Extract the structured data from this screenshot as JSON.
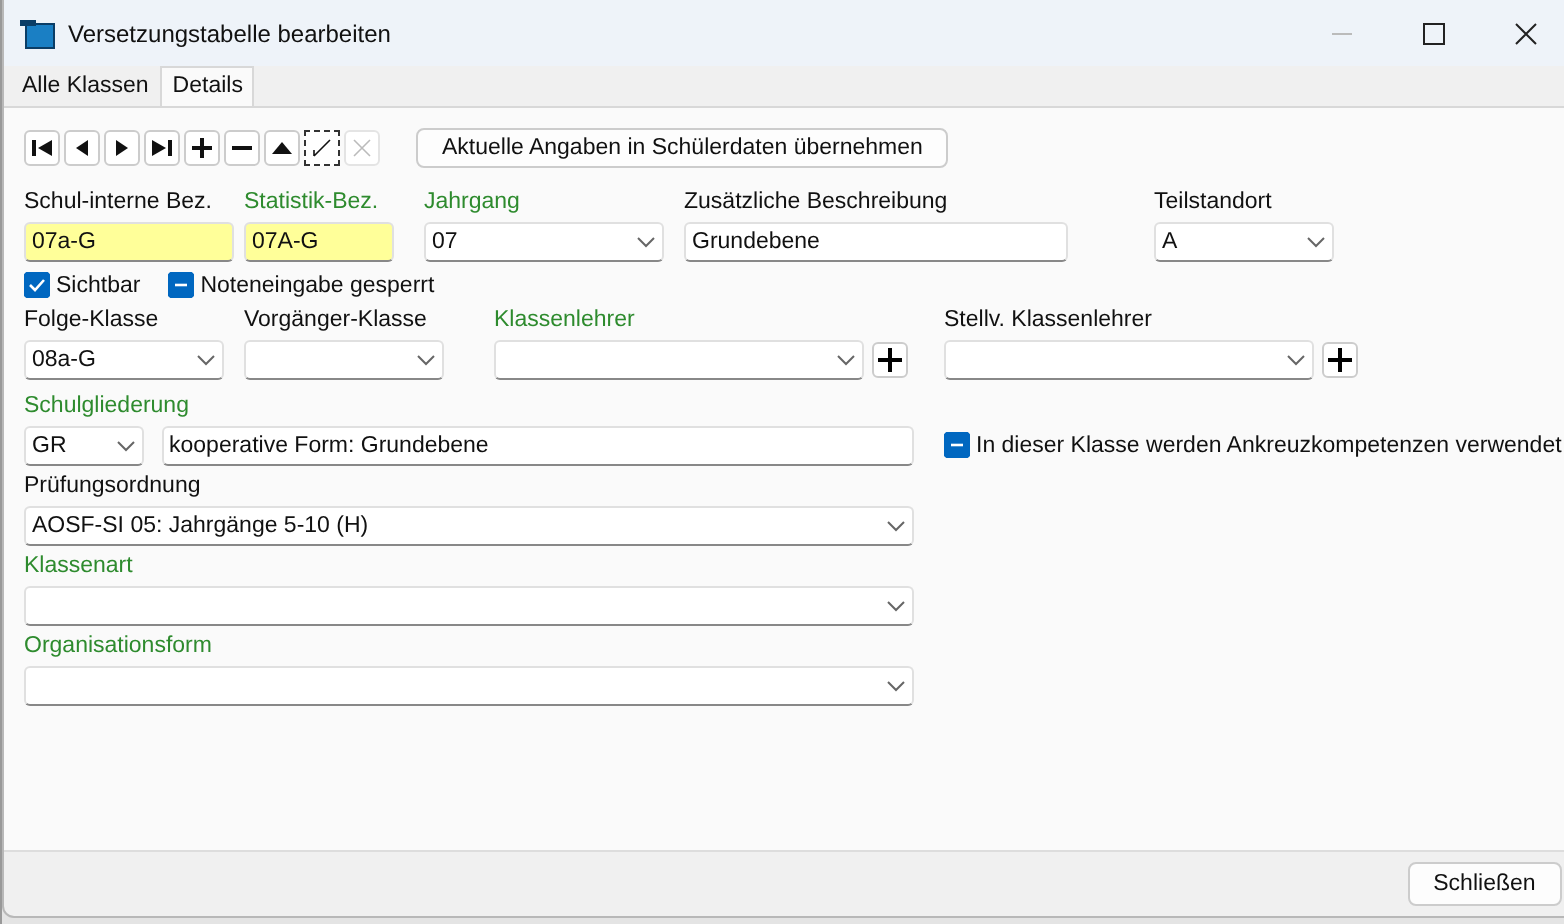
{
  "window": {
    "title": "Versetzungstabelle bearbeiten"
  },
  "tabs": [
    {
      "label": "Alle Klassen",
      "selected": false
    },
    {
      "label": "Details",
      "selected": true
    }
  ],
  "toolbar": {
    "buttons": [
      {
        "kind": "first",
        "disabled": false
      },
      {
        "kind": "prev",
        "disabled": false
      },
      {
        "kind": "next",
        "disabled": false
      },
      {
        "kind": "last",
        "disabled": false
      },
      {
        "kind": "add",
        "disabled": false
      },
      {
        "kind": "remove",
        "disabled": false
      },
      {
        "kind": "up",
        "disabled": false
      },
      {
        "kind": "edit",
        "disabled": false
      },
      {
        "kind": "cancel",
        "disabled": true
      }
    ],
    "apply_button": "Aktuelle Angaben in Schülerdaten übernehmen"
  },
  "fields": {
    "schul_interne_bez": {
      "label": "Schul-interne Bez.",
      "required": false,
      "value": "07a-G",
      "highlighted": true
    },
    "statistik_bez": {
      "label": "Statistik-Bez.",
      "required": true,
      "value": "07A-G",
      "highlighted": true
    },
    "jahrgang": {
      "label": "Jahrgang",
      "required": true,
      "value": "07"
    },
    "beschreibung": {
      "label": "Zusätzliche Beschreibung",
      "required": false,
      "value": "Grundebene"
    },
    "teilstandort": {
      "label": "Teilstandort",
      "required": false,
      "value": "A"
    },
    "folge_klasse": {
      "label": "Folge-Klasse",
      "required": false,
      "value": "08a-G"
    },
    "vorgaenger_klasse": {
      "label": "Vorgänger-Klasse",
      "required": false
    },
    "klassenlehrer": {
      "label": "Klassenlehrer",
      "required": true
    },
    "stellv_klassenlehrer": {
      "label": "Stellv. Klassenlehrer",
      "required": false
    },
    "schulgliederung": {
      "label": "Schulgliederung",
      "required": true,
      "value": "GR",
      "description": "kooperative Form: Grundebene"
    },
    "pruefungsordnung": {
      "label": "Prüfungsordnung",
      "required": false,
      "value": "AOSF-SI 05: Jahrgänge 5-10 (H)"
    },
    "klassenart": {
      "label": "Klassenart",
      "required": true
    },
    "organisationsform": {
      "label": "Organisationsform",
      "required": true
    }
  },
  "checkboxes": [
    {
      "label": "Sichtbar",
      "checked": true,
      "indeterminate": false
    },
    {
      "label": "Noteneingabe gesperrt",
      "checked": false,
      "indeterminate": true
    },
    {
      "label": "In dieser Klasse werden Ankreuzkompetenzen verwendet",
      "checked": false,
      "indeterminate": true
    }
  ],
  "close_button": "Schließen"
}
